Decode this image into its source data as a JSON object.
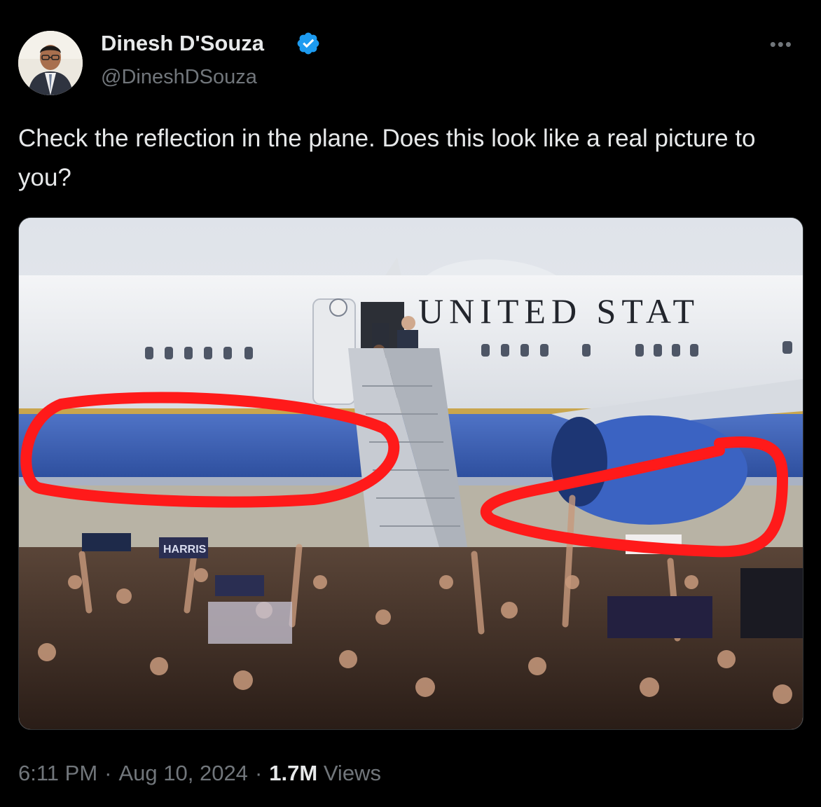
{
  "author": {
    "name": "Dinesh D'Souza",
    "handle": "@DineshDSouza",
    "verified": true,
    "verified_color": "#1d9bf0"
  },
  "more_icon": "more-horizontal-icon",
  "tweet_text": "Check the reflection in the plane. Does this look like a real picture to you?",
  "media": {
    "plane_lettering": "UNITED STAT",
    "sign_text": "HARRIS",
    "highlight_color": "#ff1a1a"
  },
  "footer": {
    "time": "6:11 PM",
    "date": "Aug 10, 2024",
    "views_count": "1.7M",
    "views_label": "Views",
    "separator": "·"
  }
}
